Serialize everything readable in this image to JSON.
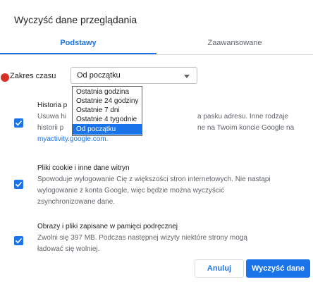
{
  "dialog": {
    "title": "Wyczyść dane przeglądania",
    "tabs": [
      {
        "label": "Podstawy",
        "active": true
      },
      {
        "label": "Zaawansowane",
        "active": false
      }
    ],
    "time_range": {
      "label": "Zakres czasu",
      "selected": "Od początku",
      "options": [
        "Ostatnia godzina",
        "Ostatnie 24 godziny",
        "Ostatnie 7 dni",
        "Ostatnie 4 tygodnie",
        "Od początku"
      ],
      "highlighted_option": "Od początku"
    },
    "items": [
      {
        "checked": true,
        "title": "Historia p",
        "desc_lines": [
          "Usuwa hi",
          "historii p"
        ],
        "desc_right_lines": [
          "a pasku adresu. Inne rodzaje",
          "ne na Twoim koncie Google na"
        ],
        "link": "myactivity.google.com."
      },
      {
        "checked": true,
        "title": "Pliki cookie i inne dane witryn",
        "desc_lines": [
          "Spowoduje wylogowanie Cię z większości stron internetowych. Nie nastąpi",
          "wylogowanie z konta Google, więc będzie można wyczyścić",
          "zsynchronizowane dane."
        ]
      },
      {
        "checked": true,
        "title": "Obrazy i pliki zapisane w pamięci podręcznej",
        "desc_lines": [
          "Zwolni się 397 MB. Podczas następnej wizyty niektóre strony mogą",
          "ładować się wolniej."
        ]
      }
    ],
    "buttons": {
      "cancel": "Anuluj",
      "clear": "Wyczyść dane"
    },
    "colors": {
      "accent": "#1a73e8",
      "marker": "#d93025",
      "text": "#202124",
      "secondary_text": "#5f6368"
    }
  }
}
